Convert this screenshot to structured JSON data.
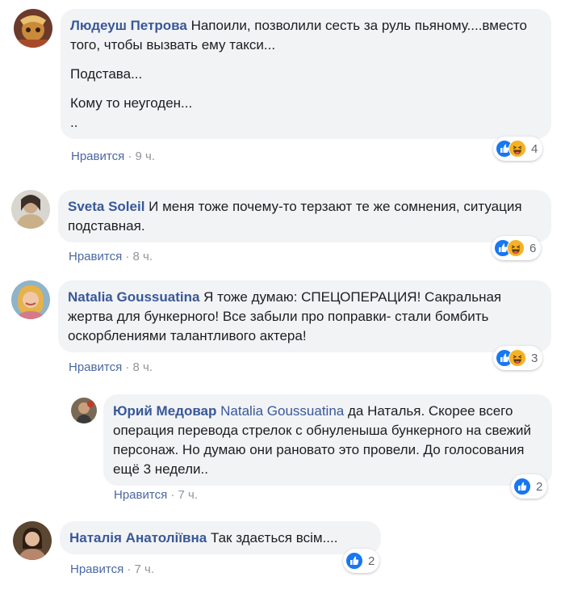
{
  "comments": [
    {
      "author": "Людеуш Петрова",
      "text_first": "Напоили, позволили сесть за руль пьяному....вместо того, чтобы вызвать ему такси...",
      "para2": "Подстава...",
      "para3": "Кому то неугоден...",
      "para4": "..",
      "like_label": "Нравится",
      "sep": "·",
      "time": "9 ч.",
      "reaction_count": "4",
      "reactions": [
        "like-icon",
        "haha-icon"
      ]
    },
    {
      "author": "Sveta Soleil",
      "text": "И меня тоже почему-то терзают те же сомнения, ситуация подставная.",
      "like_label": "Нравится",
      "sep": "·",
      "time": "8 ч.",
      "reaction_count": "6",
      "reactions": [
        "like-icon",
        "haha-icon"
      ]
    },
    {
      "author": "Natalia Goussuatina",
      "text": "Я тоже думаю: СПЕЦОПЕРАЦИЯ! Сакральная жертва для бункерного! Все забыли про поправки- стали бомбить оскорблениями талантливого актера!",
      "like_label": "Нравится",
      "sep": "·",
      "time": "8 ч.",
      "reaction_count": "3",
      "reactions": [
        "like-icon",
        "haha-icon"
      ]
    },
    {
      "author": "Юрий Медовар",
      "mention": "Natalia Goussuatina",
      "text": "да Наталья. Скорее всего операция перевода стрелок с обнуленыша бункерного на свежий персонаж. Но думаю они рановато это провели. До голосования ещё 3 недели..",
      "like_label": "Нравится",
      "sep": "·",
      "time": "7 ч.",
      "reaction_count": "2",
      "reactions": [
        "like-icon"
      ]
    },
    {
      "author": "Наталія Анатоліївна",
      "text": "Так здається всім....",
      "like_label": "Нравится",
      "sep": "·",
      "time": "7 ч.",
      "reaction_count": "2",
      "reactions": [
        "like-icon"
      ]
    }
  ],
  "colors": {
    "author": "#385898",
    "bubble": "#f2f3f5",
    "meta": "#90949c",
    "like_blue": "#1877f2"
  }
}
